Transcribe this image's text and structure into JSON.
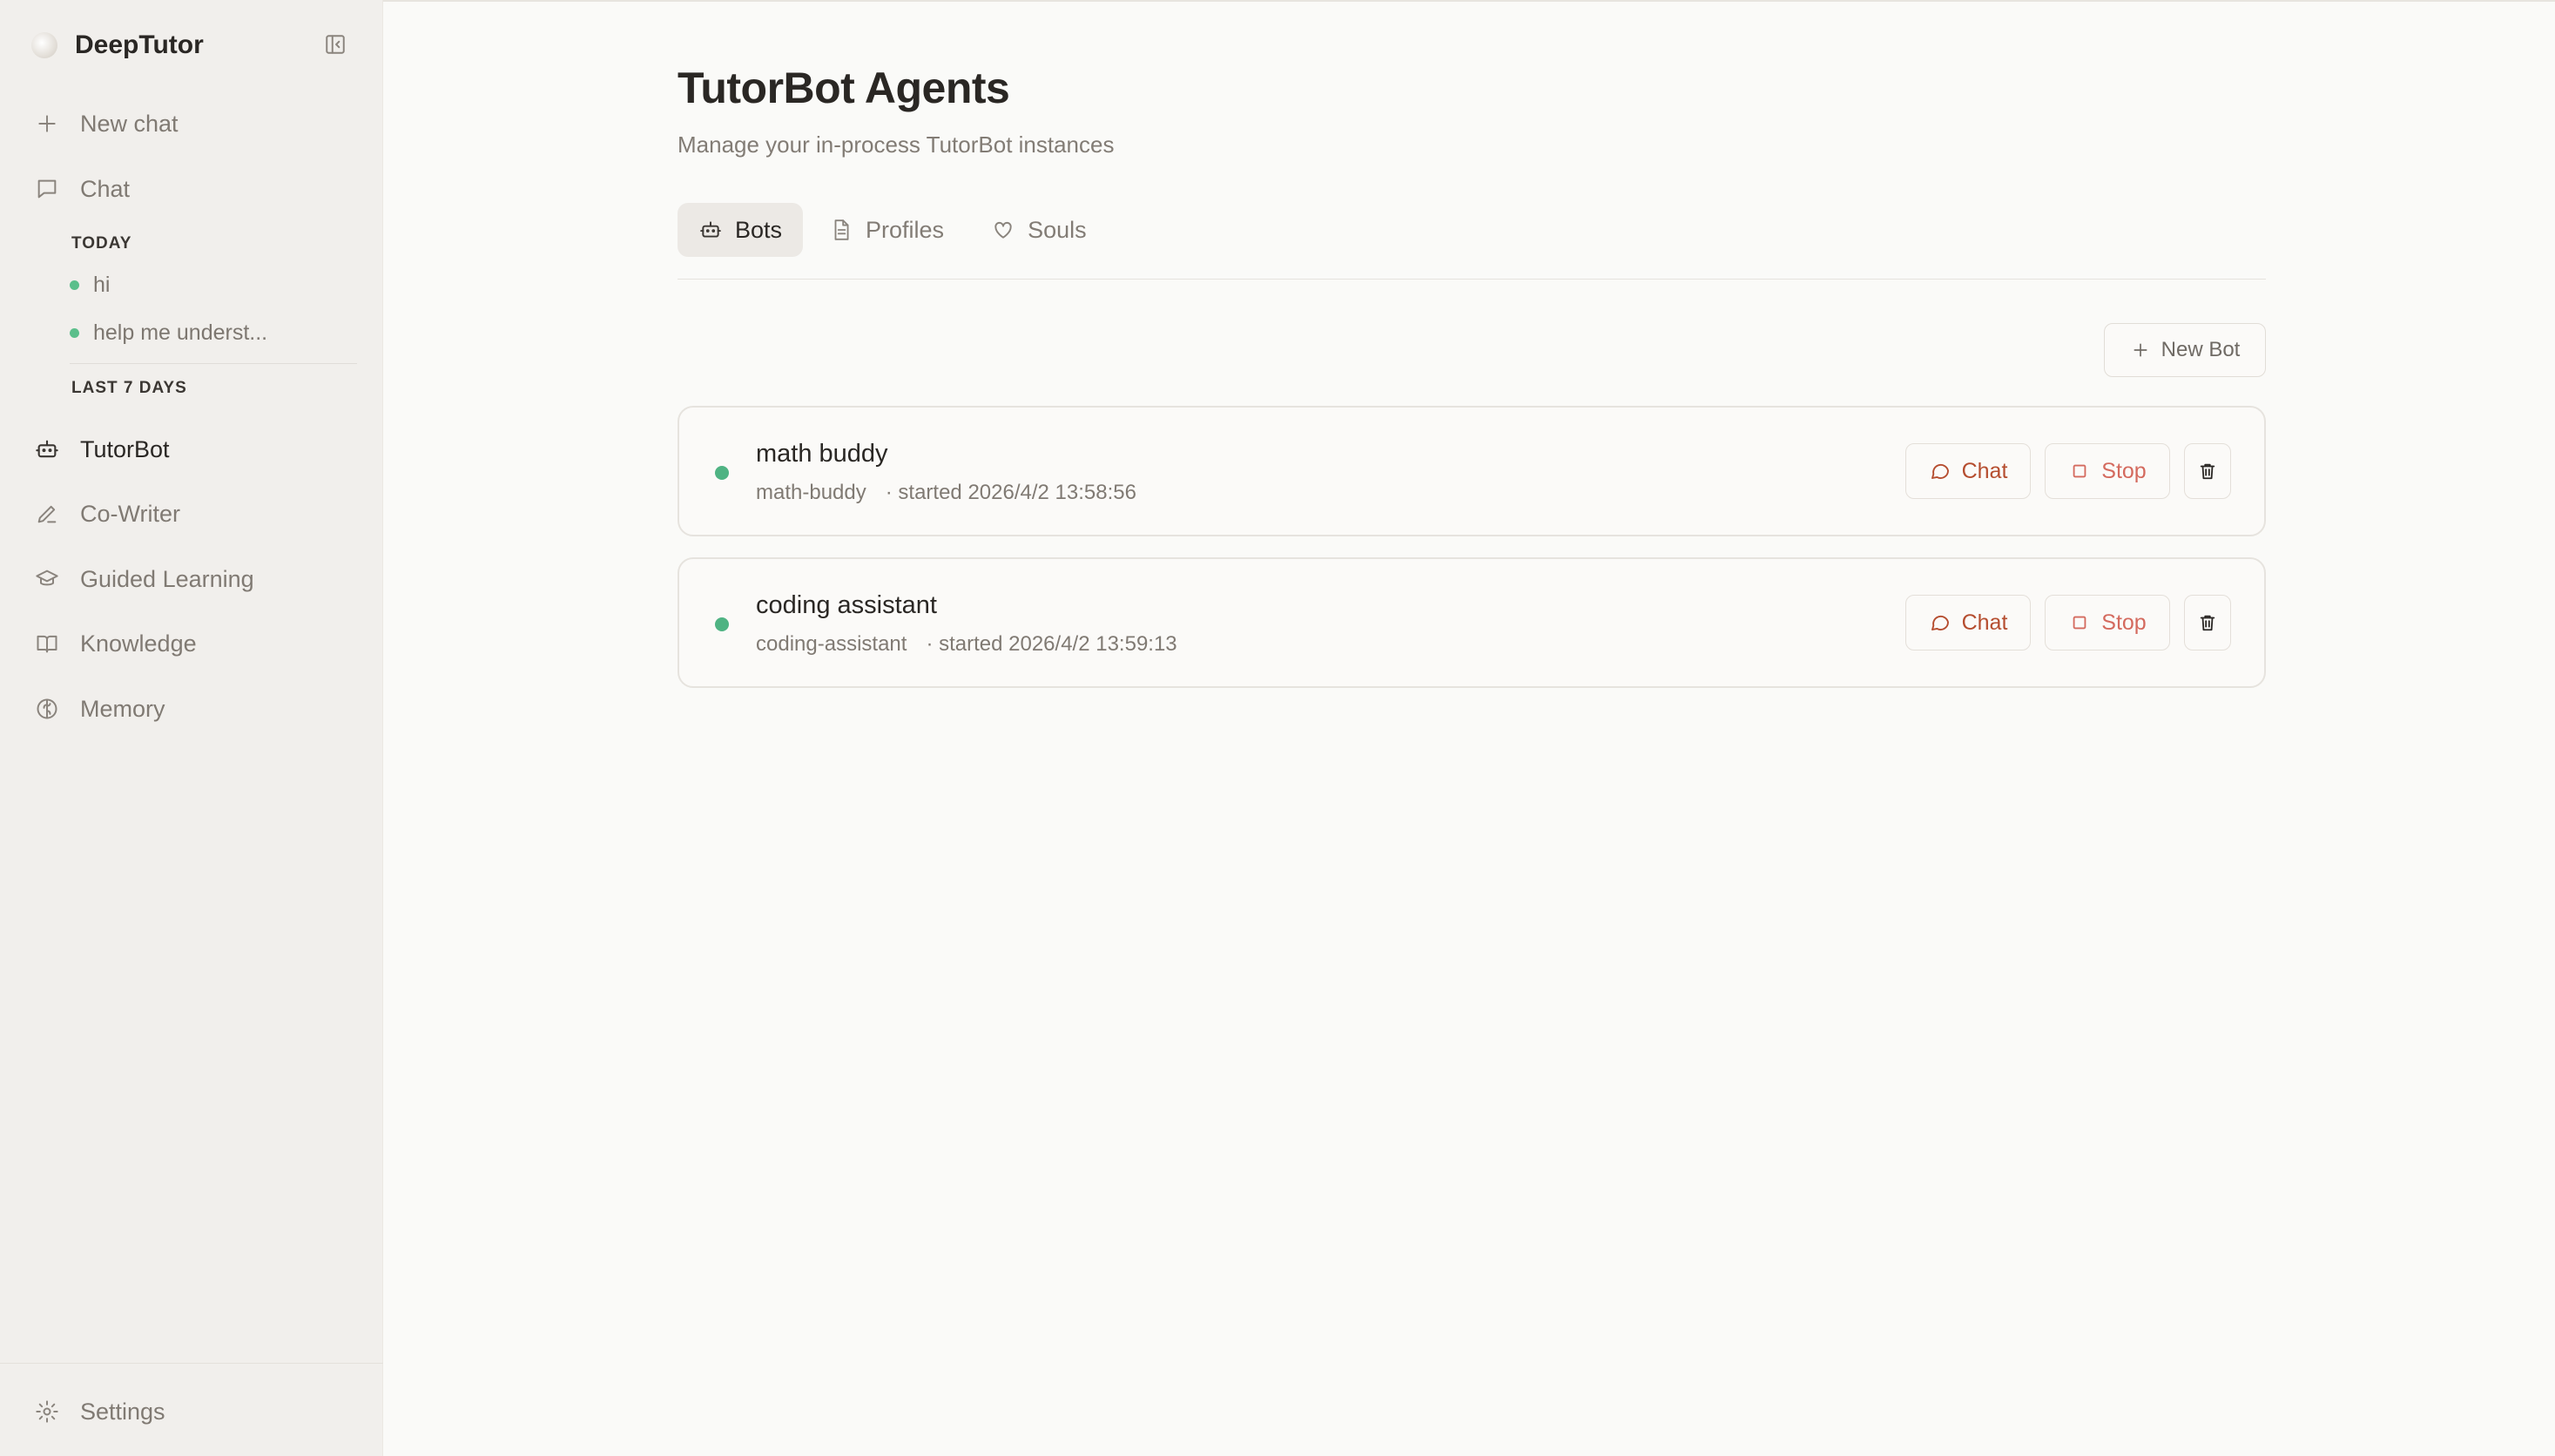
{
  "app": {
    "name": "DeepTutor"
  },
  "sidebar": {
    "new_chat": "New chat",
    "chat": "Chat",
    "groups": {
      "today": "TODAY",
      "last7": "LAST 7 DAYS"
    },
    "history_today": [
      {
        "title": "hi"
      },
      {
        "title": "help me underst..."
      }
    ],
    "items": [
      {
        "label": "TutorBot",
        "icon": "robot-icon",
        "active": true
      },
      {
        "label": "Co-Writer",
        "icon": "pen-icon"
      },
      {
        "label": "Guided Learning",
        "icon": "graduation-cap-icon"
      },
      {
        "label": "Knowledge",
        "icon": "book-icon"
      },
      {
        "label": "Memory",
        "icon": "brain-icon"
      }
    ],
    "settings": "Settings"
  },
  "page": {
    "title": "TutorBot Agents",
    "subtitle": "Manage your in-process TutorBot instances"
  },
  "tabs": [
    {
      "label": "Bots",
      "icon": "robot-icon",
      "active": true
    },
    {
      "label": "Profiles",
      "icon": "document-icon"
    },
    {
      "label": "Souls",
      "icon": "heart-icon"
    }
  ],
  "actions": {
    "new_bot": "New Bot"
  },
  "bots": [
    {
      "name": "math buddy",
      "id": "math-buddy",
      "started": "· started 2026/4/2 13:58:56",
      "status": "running",
      "chat_label": "Chat",
      "stop_label": "Stop"
    },
    {
      "name": "coding assistant",
      "id": "coding-assistant",
      "started": "· started 2026/4/2 13:59:13",
      "status": "running",
      "chat_label": "Chat",
      "stop_label": "Stop"
    }
  ],
  "colors": {
    "accent": "#b54d2f",
    "stop": "#d46a5e",
    "running": "#4fb383",
    "sidebar_bg": "#f1efec",
    "page_bg": "#fafaf8"
  }
}
